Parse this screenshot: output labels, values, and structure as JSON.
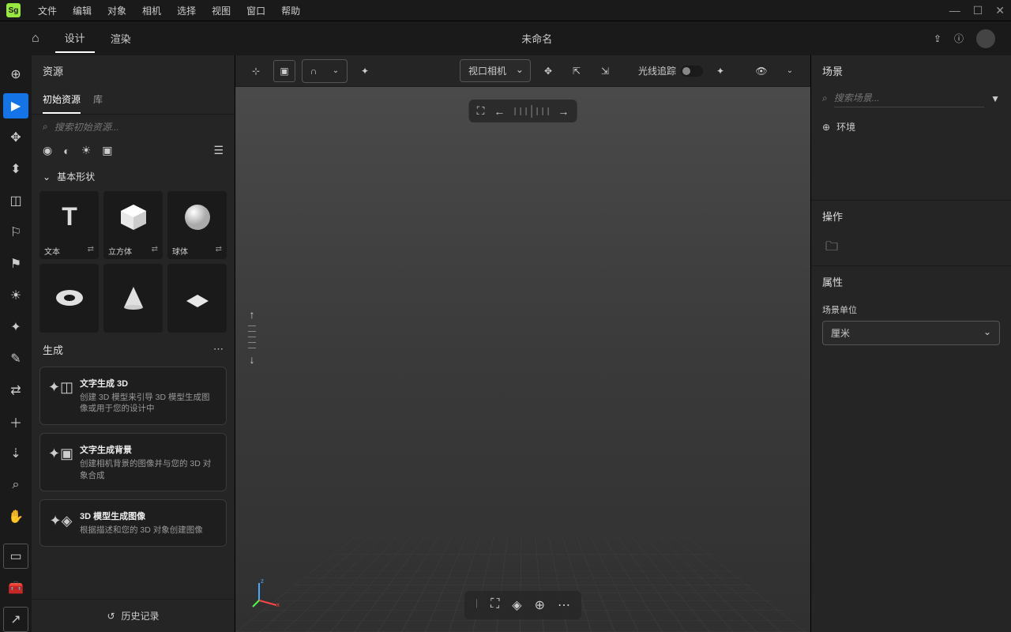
{
  "app": {
    "logo": "Sg"
  },
  "menu": [
    "文件",
    "编辑",
    "对象",
    "相机",
    "选择",
    "视图",
    "窗口",
    "帮助"
  ],
  "toolbar": {
    "tabs": {
      "design": "设计",
      "render": "渲染"
    },
    "title": "未命名"
  },
  "assets": {
    "header": "资源",
    "tabs": {
      "starter": "初始资源",
      "library": "库"
    },
    "search_placeholder": "搜索初始资源...",
    "section_basic": "基本形状",
    "items": [
      {
        "label": "文本"
      },
      {
        "label": "立方体"
      },
      {
        "label": "球体"
      }
    ],
    "gen_header": "生成",
    "gen_cards": [
      {
        "title": "文字生成 3D",
        "desc": "创建 3D 模型来引导 3D 模型生成图像或用于您的设计中"
      },
      {
        "title": "文字生成背景",
        "desc": "创建相机背景的图像并与您的 3D 对象合成"
      },
      {
        "title": "3D 模型生成图像",
        "desc": "根据描述和您的 3D 对象创建图像"
      }
    ],
    "history": "历史记录"
  },
  "viewport": {
    "camera": "视口相机",
    "raytrace": "光线追踪"
  },
  "scene": {
    "header": "场景",
    "search_placeholder": "搜索场景...",
    "env": "环境"
  },
  "ops": {
    "header": "操作"
  },
  "props": {
    "header": "属性",
    "unit_label": "场景单位",
    "unit_value": "厘米"
  }
}
